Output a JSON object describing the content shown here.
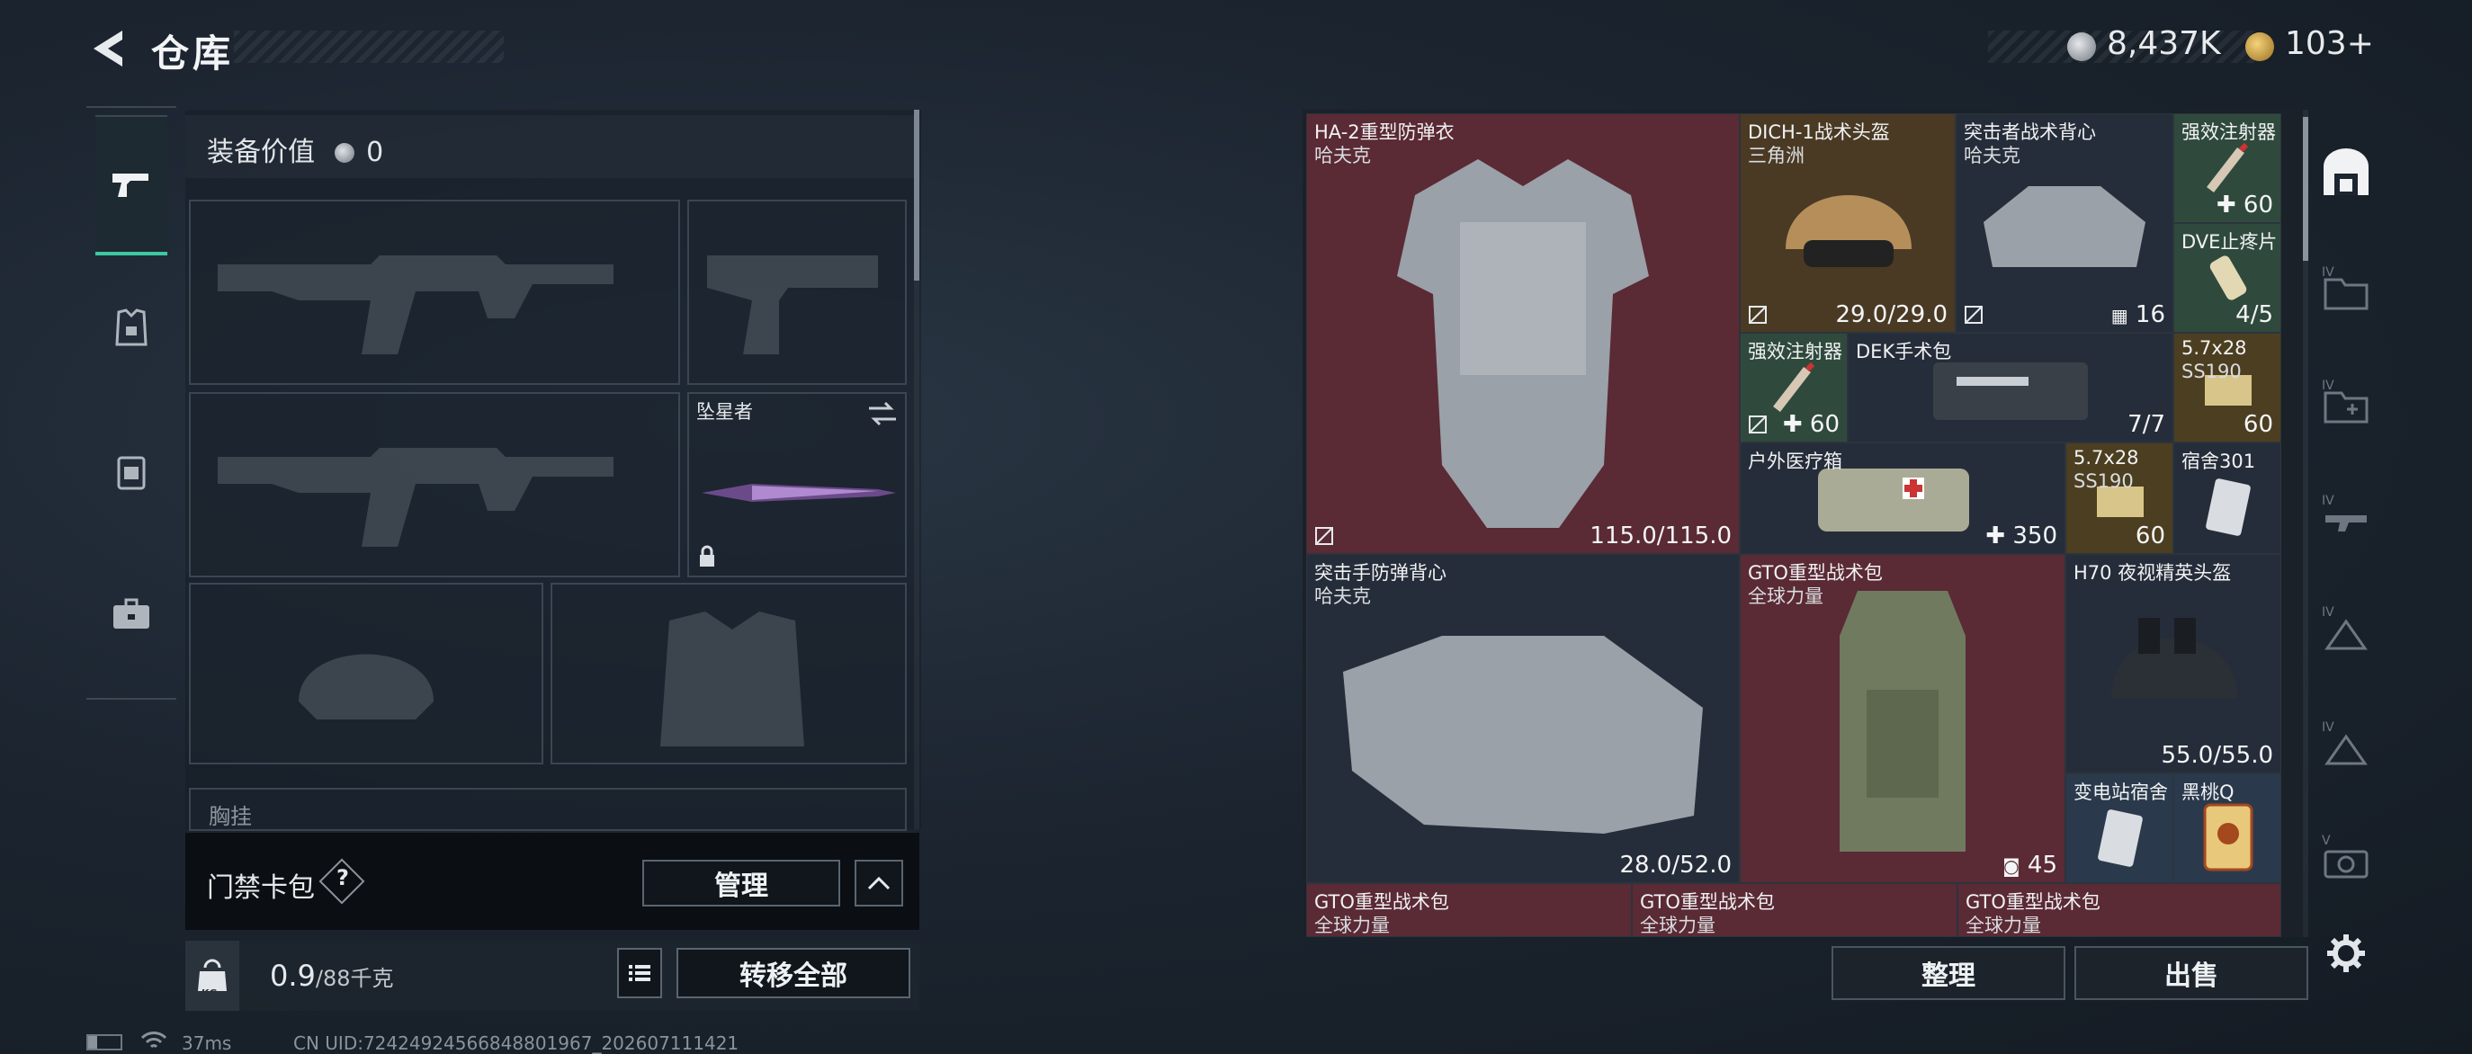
{
  "header": {
    "title": "仓库",
    "currency_1": "8,437K",
    "currency_2": "103+"
  },
  "left_tabs": [
    {
      "id": "weapons",
      "icon": "pistol-icon",
      "active": true
    },
    {
      "id": "armor",
      "icon": "armor-icon",
      "active": false
    },
    {
      "id": "backpack",
      "icon": "backpack-icon",
      "active": false
    },
    {
      "id": "case",
      "icon": "briefcase-icon",
      "active": false
    }
  ],
  "loadout": {
    "value_label": "装备价值",
    "value": "0",
    "melee_slot_name": "坠星者",
    "chest_label": "胸挂",
    "card_pack_label": "门禁卡包",
    "card_pack_help": "?",
    "manage_label": "管理",
    "weight_current": "0.9",
    "weight_max": "/88千克",
    "kg_label": "KG",
    "transfer_all_label": "转移全部"
  },
  "grid_items": [
    {
      "name": "HA-2重型防弹衣",
      "sub": "哈夫克",
      "value": "115.0/115.0",
      "bg": "red"
    },
    {
      "name": "DICH-1战术头盔",
      "sub": "三角洲",
      "value": "29.0/29.0",
      "bg": "brown"
    },
    {
      "name": "突击者战术背心",
      "sub": "哈夫克",
      "value": "16",
      "bg": "dark"
    },
    {
      "name": "强效注射器",
      "sub": "",
      "value": "60",
      "bg": "green"
    },
    {
      "name": "DVE止疼片",
      "sub": "",
      "value": "4/5",
      "bg": "green"
    },
    {
      "name": "强效注射器",
      "sub": "",
      "value": "60",
      "bg": "green"
    },
    {
      "name": "DEK手术包",
      "sub": "",
      "value": "7/7",
      "bg": "dark"
    },
    {
      "name": "5.7x28",
      "sub": "SS190",
      "value": "60",
      "bg": "gold"
    },
    {
      "name": "户外医疗箱",
      "sub": "",
      "value": "350",
      "bg": "dark"
    },
    {
      "name": "5.7x28",
      "sub": "SS190",
      "value": "60",
      "bg": "gold"
    },
    {
      "name": "宿舍301",
      "sub": "",
      "value": "",
      "bg": "dark"
    },
    {
      "name": "突击手防弹背心",
      "sub": "哈夫克",
      "value": "28.0/52.0",
      "bg": "dark"
    },
    {
      "name": "GTO重型战术包",
      "sub": "全球力量",
      "value": "45",
      "bg": "red"
    },
    {
      "name": "H70 夜视精英头盔",
      "sub": "",
      "value": "55.0/55.0",
      "bg": "dark"
    },
    {
      "name": "变电站宿舍",
      "sub": "",
      "value": "",
      "bg": "blue"
    },
    {
      "name": "黑桃Q",
      "sub": "",
      "value": "",
      "bg": "blue"
    },
    {
      "name": "GTO重型战术包",
      "sub": "全球力量",
      "value": "",
      "bg": "red"
    },
    {
      "name": "GTO重型战术包",
      "sub": "全球力量",
      "value": "",
      "bg": "red"
    },
    {
      "name": "GTO重型战术包",
      "sub": "全球力量",
      "value": "",
      "bg": "red"
    }
  ],
  "actions": {
    "sort_label": "整理",
    "sell_label": "出售"
  },
  "right_rail": [
    {
      "icon": "safebox-icon",
      "badge": ""
    },
    {
      "icon": "folder-icon",
      "badge": "IV"
    },
    {
      "icon": "add-folder-icon",
      "badge": "IV"
    },
    {
      "icon": "rifle-tab-icon",
      "badge": "IV"
    },
    {
      "icon": "triangle-tab-icon",
      "badge": "IV"
    },
    {
      "icon": "triangle-tab-icon",
      "badge": "IV"
    },
    {
      "icon": "camera-tab-icon",
      "badge": "V"
    }
  ],
  "status_bar": {
    "ping": "37ms",
    "uid": "CN UID:72424924566848801967_202607111421"
  }
}
